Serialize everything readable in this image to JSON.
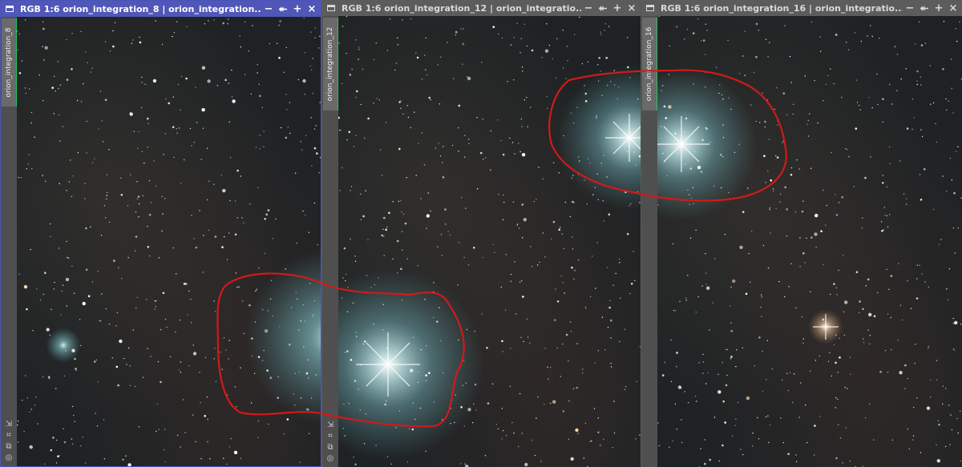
{
  "windows": [
    {
      "title": "RGB 1:6 orion_integration_8 | orion_integration...",
      "tab_label": "orion_integration_8",
      "active": true
    },
    {
      "title": "RGB 1:6 orion_integration_12 | orion_integratio...",
      "tab_label": "orion_integration_12",
      "active": false
    },
    {
      "title": "RGB 1:6 orion_integration_16 | orion_integratio...",
      "tab_label": "orion_integration_16",
      "active": false
    }
  ],
  "controls": {
    "minimize": "−",
    "shade": "⯬",
    "maximize": "+",
    "close": "×"
  },
  "tools": [
    "⇲",
    "⌗",
    "⧉",
    "◎"
  ],
  "colors": {
    "active_title": "#5057b8",
    "inactive_title": "#5c5c5c",
    "annotation": "#d11a1a",
    "tab_indicator": "#22c55e"
  }
}
